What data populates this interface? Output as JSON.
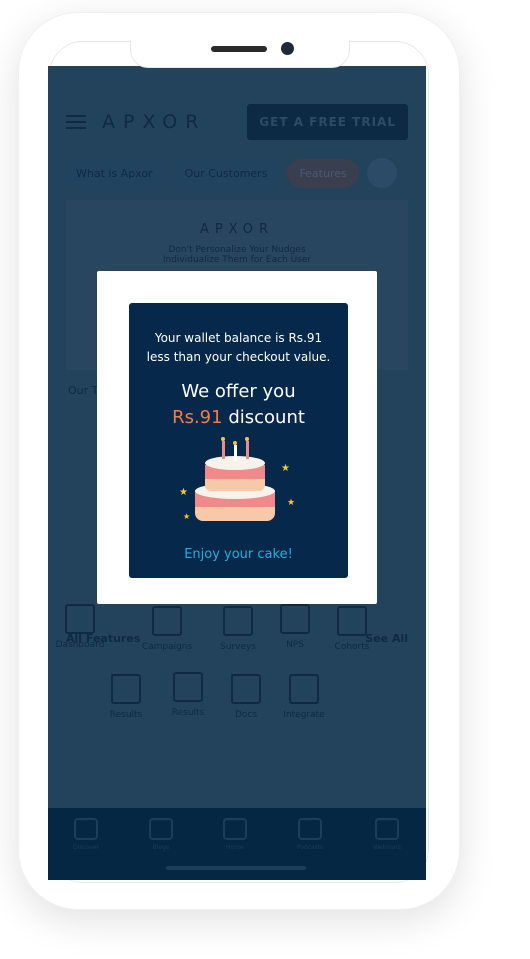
{
  "header": {
    "logo": "APXOR",
    "cta": "GET A FREE TRIAL"
  },
  "tabs": [
    {
      "label": "What is Apxor"
    },
    {
      "label": "Our Customers"
    },
    {
      "label": "Features",
      "active": true
    }
  ],
  "banner": {
    "logo": "APXOR",
    "line1": "Don't Personalize Your Nudges",
    "line2": "Individualize Them for Each User"
  },
  "section": {
    "partial_label": "Our T",
    "title": "All Features",
    "see_all": "See All"
  },
  "features": [
    {
      "label": "Dashboard",
      "icon": "grid-icon"
    },
    {
      "label": "Campaigns",
      "icon": "chat-icon"
    },
    {
      "label": "Surveys",
      "icon": "document-icon"
    },
    {
      "label": "NPS",
      "icon": "star-icon"
    },
    {
      "label": "Cohorts",
      "icon": "users-icon"
    },
    {
      "label": "Results",
      "icon": "bar-chart-icon"
    },
    {
      "label": "Results",
      "icon": "code-check-icon"
    },
    {
      "label": "Docs",
      "icon": "docs-icon"
    },
    {
      "label": "Integrate",
      "icon": "gears-icon"
    }
  ],
  "nav": [
    {
      "label": "Discover",
      "icon": "search-icon"
    },
    {
      "label": "Blogs",
      "icon": "blog-icon"
    },
    {
      "label": "Home",
      "icon": "home-icon"
    },
    {
      "label": "Podcasts",
      "icon": "headphones-icon"
    },
    {
      "label": "Webinars",
      "icon": "webinar-icon"
    }
  ],
  "modal": {
    "line1": "Your wallet balance is Rs.91",
    "line2": "less than your checkout value.",
    "offer": "We offer you",
    "amount": "Rs.91",
    "discount": " discount",
    "footer": "Enjoy your cake!",
    "accent": "#f07e4a",
    "footer_color": "#1ab1e0"
  }
}
